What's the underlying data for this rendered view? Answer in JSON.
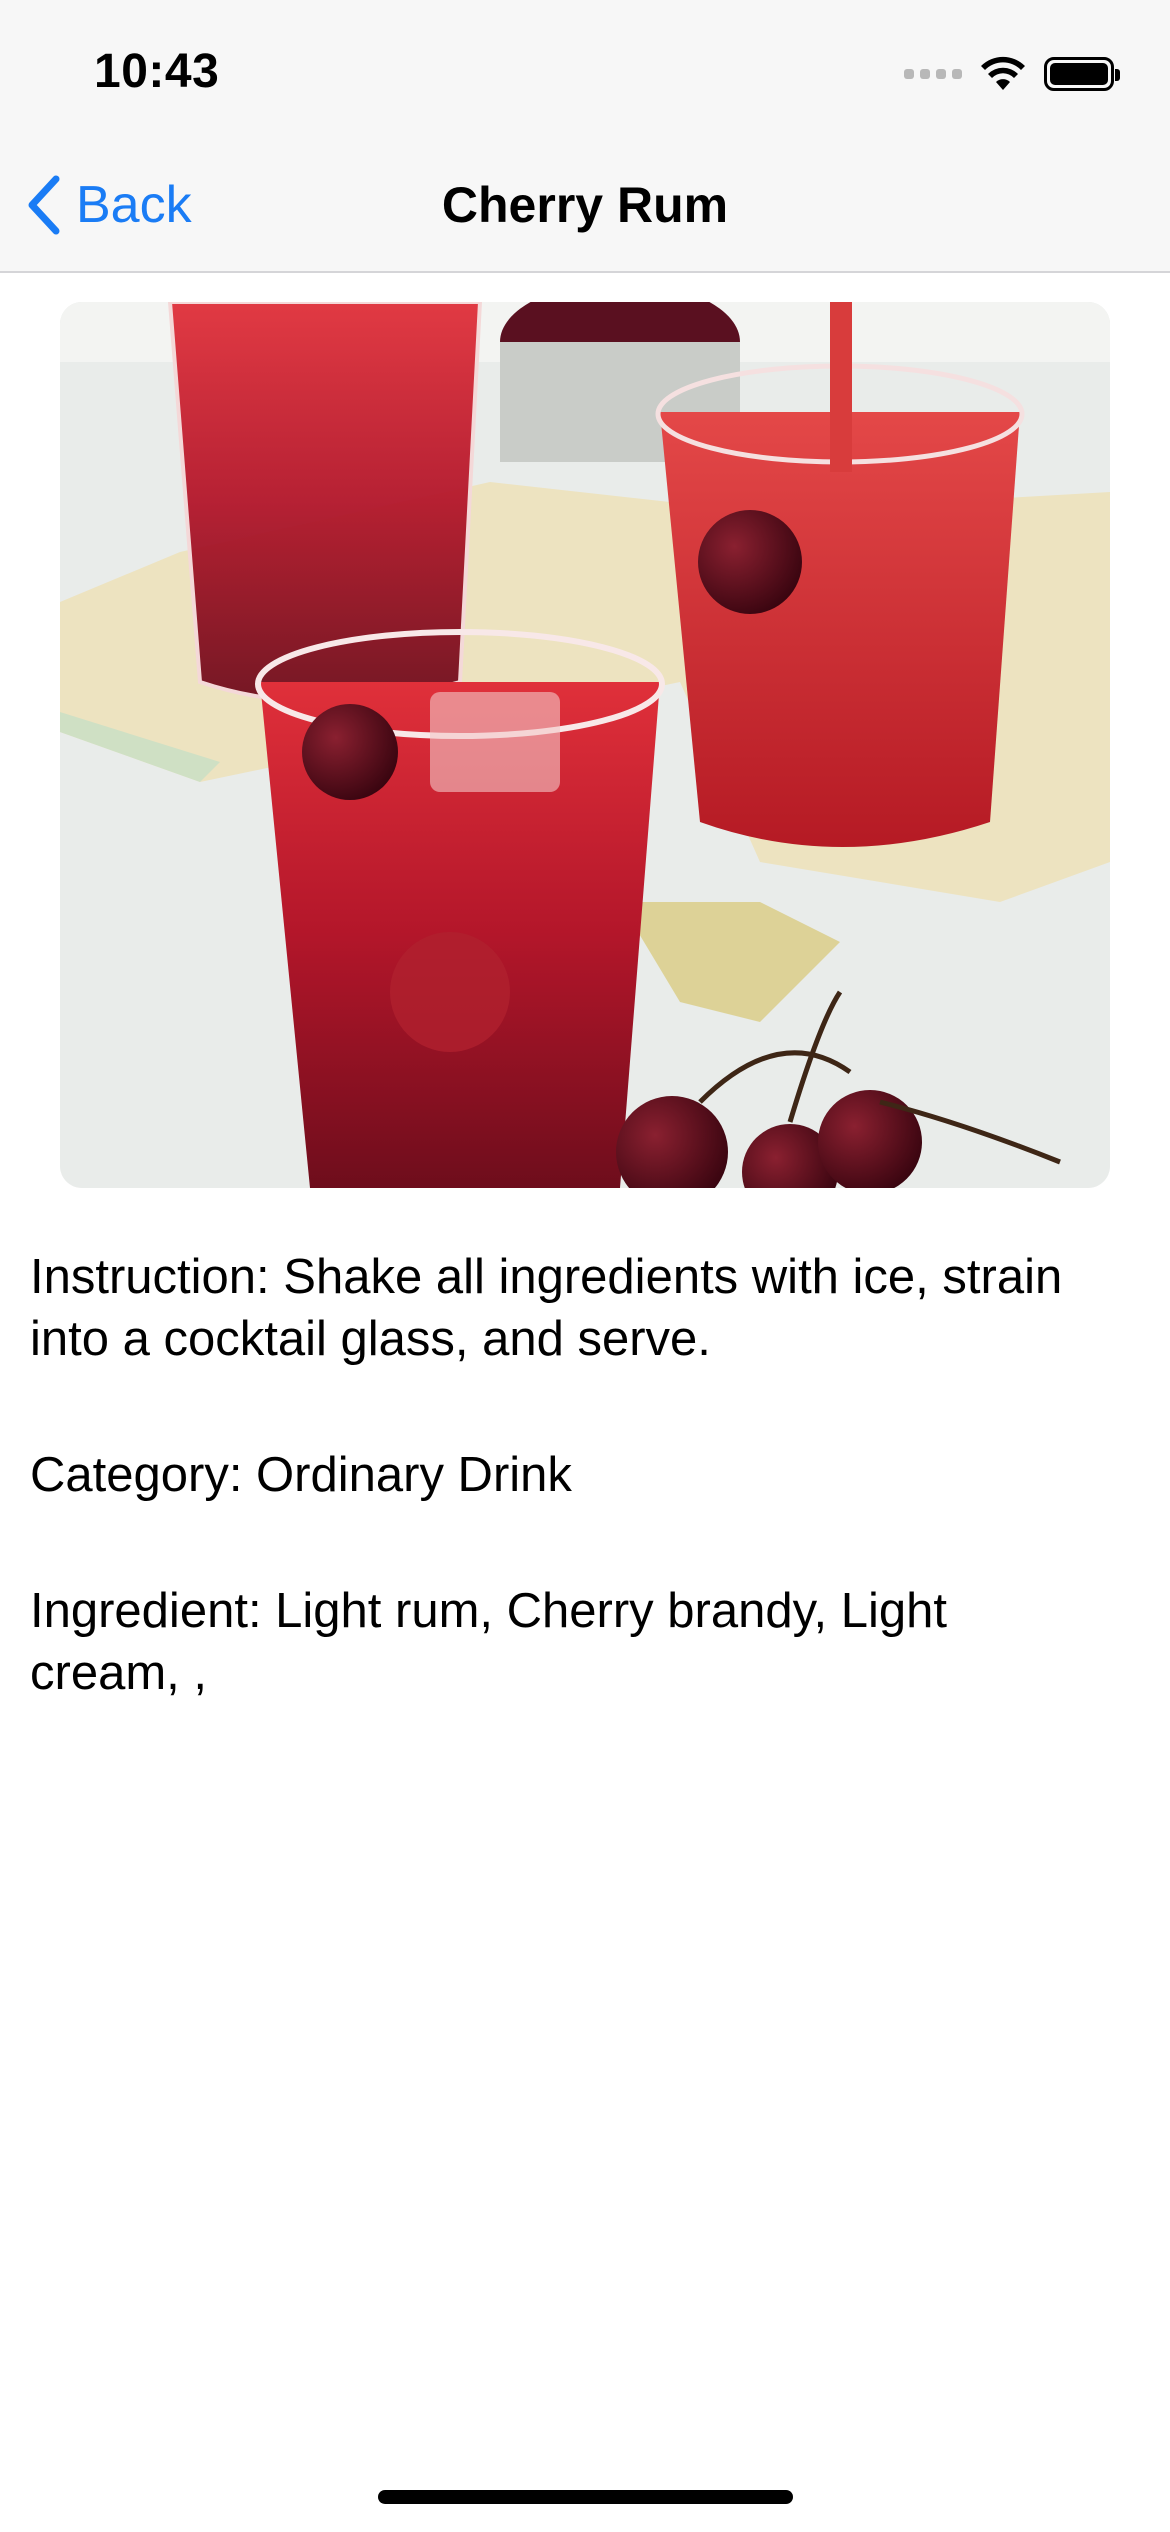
{
  "status_bar": {
    "time": "10:43",
    "icons": [
      "cellular-signal-icon",
      "wifi-icon",
      "battery-icon"
    ]
  },
  "nav": {
    "back_label": "Back",
    "title": "Cherry Rum"
  },
  "drink": {
    "image_subject": "cherry-rum-drink-photo",
    "instruction": "Instruction: Shake all ingredients with ice, strain into a cocktail glass, and serve.",
    "category": "Category: Ordinary Drink",
    "ingredient": "Ingredient: Light rum, Cherry brandy, Light cream, ,"
  },
  "colors": {
    "accent": "#1a7cf5",
    "bar_background": "#f7f7f7",
    "drink_red": "#b3162a"
  }
}
